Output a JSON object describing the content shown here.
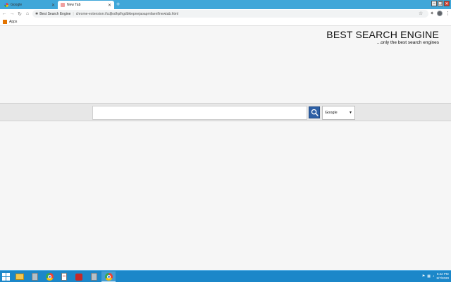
{
  "tabs": [
    {
      "label": "Google",
      "active": false,
      "favicon": "google-favicon"
    },
    {
      "label": "New Tab",
      "active": true,
      "favicon": "new-tab-favicon"
    }
  ],
  "toolbar": {
    "site_name": "Best Search Engine",
    "url": "chrome-extension://cdjlodhplhgdbkiepnejaoapmfaenf/newtab.html"
  },
  "bookmarks": {
    "apps_label": "Apps"
  },
  "page": {
    "title": "BEST SEARCH ENGINE",
    "tagline": "...only the best search engines",
    "search_placeholder": "",
    "engine_selected": "Google"
  },
  "taskbar": {
    "clock_time": "5:22 PM",
    "clock_date": "8/7/2020"
  },
  "colors": {
    "tabstrip": "#3fa7d9",
    "search_button": "#2d5fa5",
    "taskbar": "#1b87c9"
  }
}
